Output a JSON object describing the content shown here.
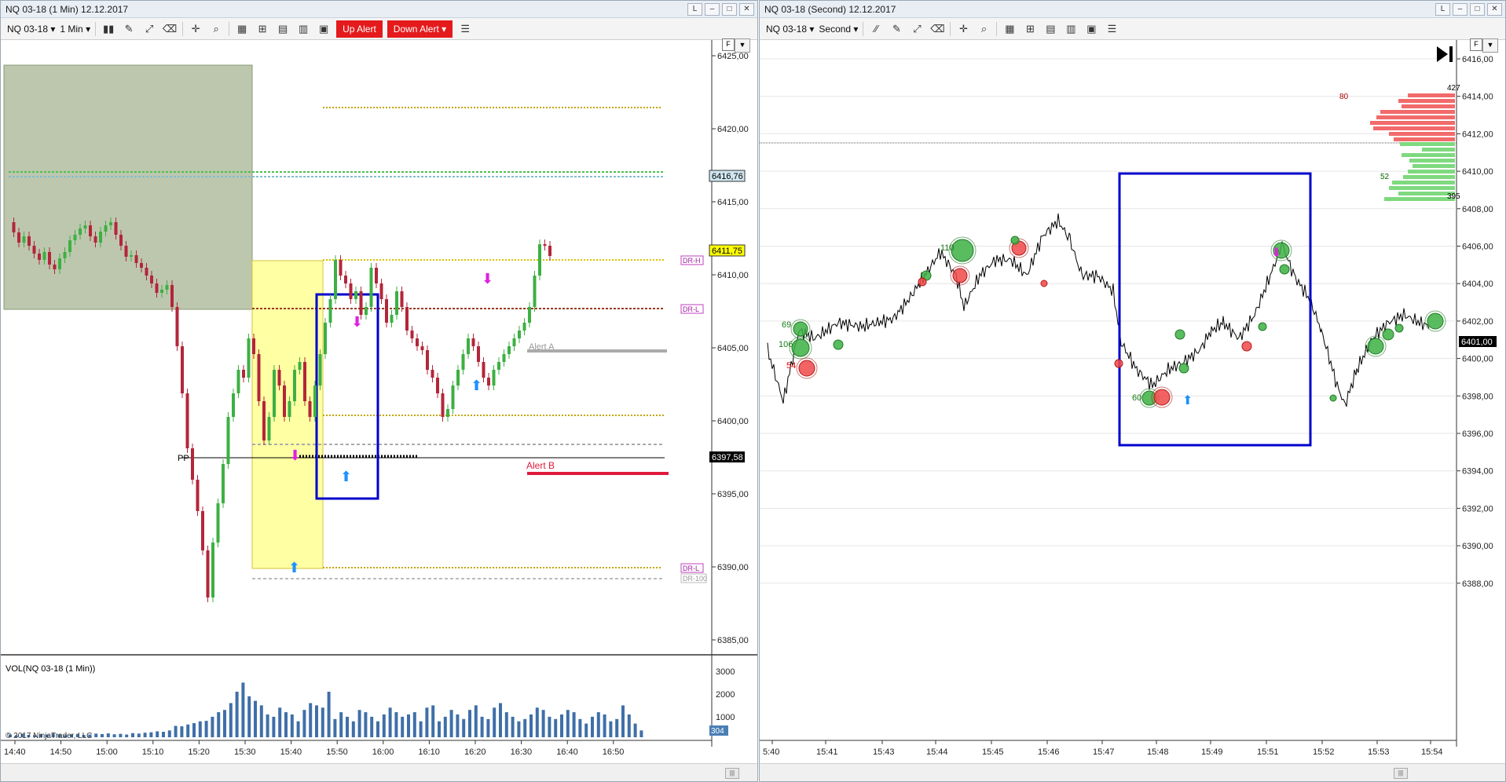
{
  "left": {
    "title": "NQ 03-18 (1 Min)  12.12.2017",
    "instrument": "NQ 03-18",
    "interval": "1 Min",
    "up_alert": "Up Alert",
    "down_alert": "Down Alert",
    "price_ticks": [
      "6425,00",
      "6420,00",
      "6415,00",
      "6410,00",
      "6405,00",
      "6400,00",
      "6395,00",
      "6390,00",
      "6385,00"
    ],
    "time_ticks": [
      "14:40",
      "14:50",
      "15:00",
      "15:10",
      "15:20",
      "15:30",
      "15:40",
      "15:50",
      "16:00",
      "16:10",
      "16:20",
      "16:30",
      "16:40",
      "16:50"
    ],
    "last_price": "6411,75",
    "level_blue": "6416,76",
    "pp_price": "6397,58",
    "pp_label": "PP",
    "alert_a": "Alert A",
    "alert_b": "Alert B",
    "dr_h": "DR-H",
    "dr_l1": "DR-L",
    "dr_l2": "DR-L",
    "dr_100": "DR-100",
    "vol_label": "VOL(NQ 03-18 (1 Min))",
    "vol_ticks": [
      "3000",
      "2000",
      "1000"
    ],
    "vol_last": "304",
    "copyright": "© 2017 NinjaTrader, LLC",
    "colors": {
      "up": "#3cb043",
      "down": "#b3263a",
      "alert": "#e41a1c",
      "blue_box": "#0000cc"
    }
  },
  "right": {
    "title": "NQ 03-18 (Second)  12.12.2017",
    "instrument": "NQ 03-18",
    "interval": "Second",
    "price_ticks": [
      "6416,00",
      "6414,00",
      "6412,00",
      "6410,00",
      "6408,00",
      "6406,00",
      "6404,00",
      "6402,00",
      "6400,00",
      "6398,00",
      "6396,00",
      "6394,00",
      "6392,00",
      "6390,00",
      "6388,00"
    ],
    "time_ticks": [
      "5:40",
      "15:41",
      "15:43",
      "15:44",
      "15:45",
      "15:46",
      "15:47",
      "15:48",
      "15:49",
      "15:51",
      "15:52",
      "15:53",
      "15:54"
    ],
    "last_price": "6401,00",
    "ladder_top": "427",
    "ladder_bottom": "395",
    "ladder_ask_size": "80",
    "ladder_bid_size": "52",
    "marker_labels": [
      "69",
      "106",
      "54",
      "110",
      "60"
    ]
  }
}
